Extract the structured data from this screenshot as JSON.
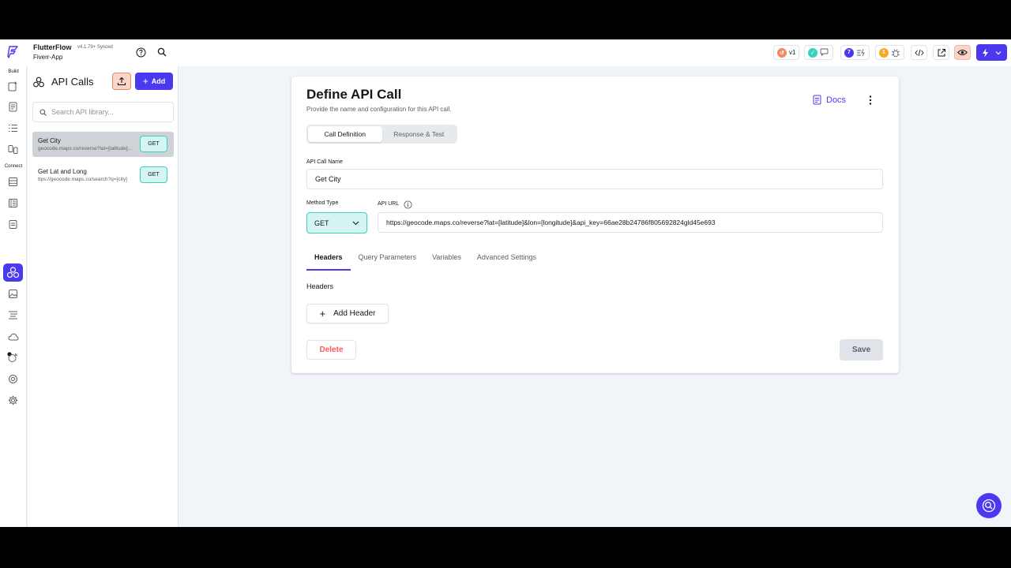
{
  "app": {
    "name": "FlutterFlow",
    "version": "v4.1.79+ Synced",
    "project": "Fiverr-App"
  },
  "toolbar": {
    "version_badge": "v1",
    "issues_count": "7",
    "warnings_count": "1"
  },
  "rail": {
    "build_label": "Build",
    "connect_label": "Connect"
  },
  "panel": {
    "title": "API Calls",
    "add_label": "Add",
    "search_placeholder": "Search API library...",
    "items": [
      {
        "name": "Get City",
        "url": "geocode.maps.co/reverse?lat=[latitude]&lon=[longitude]",
        "method": "GET"
      },
      {
        "name": "Get Lat and Long",
        "url": "ttps://geocode.maps.co/search?q=[city]",
        "method": "GET"
      }
    ]
  },
  "main": {
    "title": "Define API Call",
    "subtitle": "Provide the name and configuration for this API call.",
    "docs_label": "Docs",
    "tabs": [
      "Call Definition",
      "Response & Test"
    ],
    "call_name_label": "API Call Name",
    "call_name_value": "Get City",
    "method_label": "Method Type",
    "method_value": "GET",
    "url_label": "API URL",
    "url_value": "https://geocode.maps.co/reverse?lat=[latitude]&lon=[longitude]&api_key=66ae28b24786f805692824gld45e693",
    "sub_tabs": [
      "Headers",
      "Query Parameters",
      "Variables",
      "Advanced Settings"
    ],
    "headers_label": "Headers",
    "add_header_label": "Add Header",
    "delete_label": "Delete",
    "save_label": "Save"
  },
  "colors": {
    "accent": "#4b39ef",
    "teal": "#39d2c0",
    "danger": "#ff5963"
  }
}
